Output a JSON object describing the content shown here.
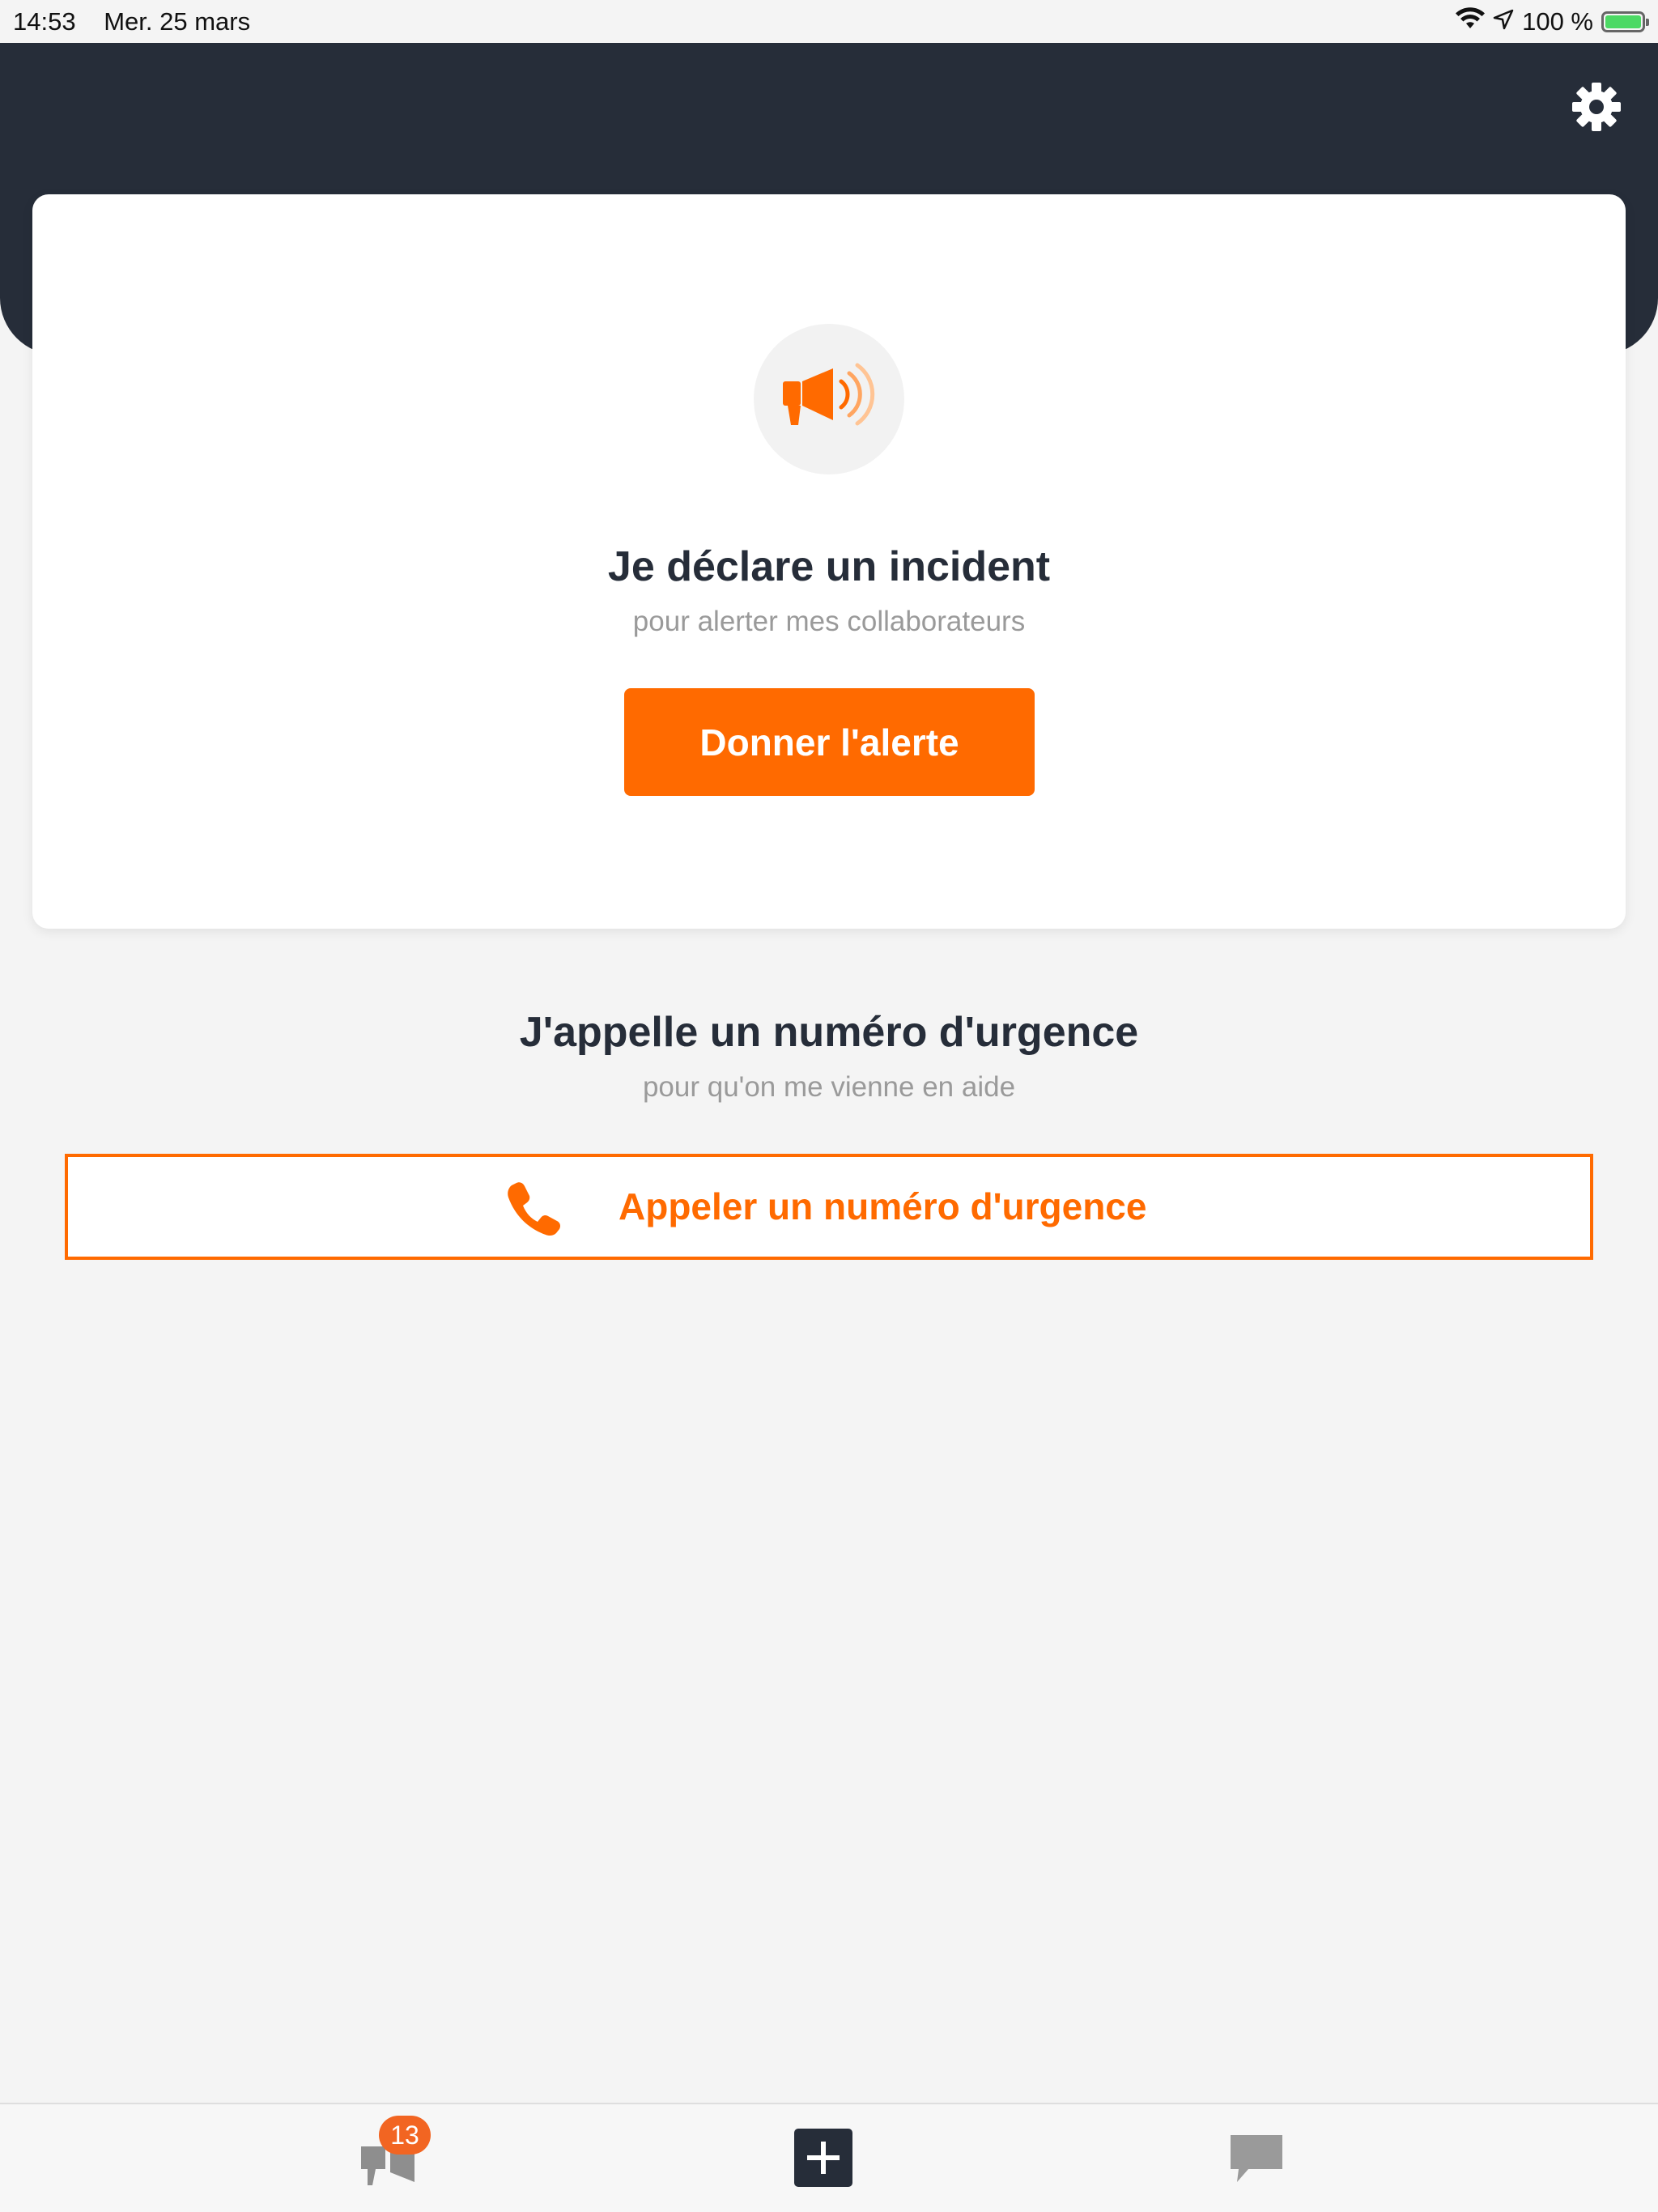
{
  "status_bar": {
    "time": "14:53",
    "date": "Mer. 25 mars",
    "battery_text": "100 %",
    "battery_level": 1.0
  },
  "header": {
    "settings_icon": "gear-icon"
  },
  "incident_card": {
    "icon": "megaphone-icon",
    "title": "Je déclare un incident",
    "subtitle": "pour alerter mes collaborateurs",
    "button_label": "Donner l'alerte"
  },
  "emergency": {
    "title": "J'appelle un numéro d'urgence",
    "subtitle": "pour qu'on me vienne en aide",
    "button_label": "Appeler un numéro d'urgence",
    "button_icon": "phone-icon"
  },
  "tab_bar": {
    "alerts_icon": "alerts-icon",
    "alerts_badge": "13",
    "new_icon": "plus-square-icon",
    "messages_icon": "chat-bubble-icon"
  },
  "colors": {
    "accent": "#ff6a00",
    "header_bg": "#262d39",
    "background": "#f4f4f4",
    "badge": "#f26522"
  }
}
